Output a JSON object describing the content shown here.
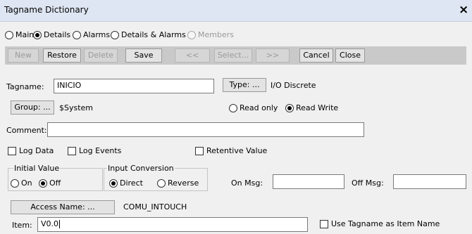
{
  "window": {
    "title": "Tagname Dictionary",
    "close_label": "×"
  },
  "view_tabs": [
    {
      "label": "Main",
      "selected": false,
      "disabled": false
    },
    {
      "label": "Details",
      "selected": true,
      "disabled": false
    },
    {
      "label": "Alarms",
      "selected": false,
      "disabled": false
    },
    {
      "label": "Details & Alarms",
      "selected": false,
      "disabled": false
    },
    {
      "label": "Members",
      "selected": false,
      "disabled": true
    }
  ],
  "toolbar": {
    "new": "New",
    "restore": "Restore",
    "delete": "Delete",
    "save": "Save",
    "prev": "<<",
    "select": "Select...",
    "next": ">>",
    "cancel": "Cancel",
    "close": "Close"
  },
  "form": {
    "tagname_label": "Tagname:",
    "tagname_value": "INICIO",
    "type_button": "Type: ...",
    "type_value": "I/O Discrete",
    "group_button": "Group: ...",
    "group_value": "$System",
    "access_options": [
      {
        "label": "Read only",
        "selected": false
      },
      {
        "label": "Read Write",
        "selected": true
      }
    ],
    "comment_label": "Comment:",
    "comment_value": "",
    "checks": {
      "log_data": "Log Data",
      "log_events": "Log Events",
      "retentive_value": "Retentive Value"
    },
    "initial_value": {
      "title": "Initial Value",
      "options": [
        {
          "label": "On",
          "selected": false
        },
        {
          "label": "Off",
          "selected": true
        }
      ]
    },
    "input_conversion": {
      "title": "Input Conversion",
      "options": [
        {
          "label": "Direct",
          "selected": true
        },
        {
          "label": "Reverse",
          "selected": false
        }
      ]
    },
    "on_msg_label": "On Msg:",
    "on_msg_value": "",
    "off_msg_label": "Off Msg:",
    "off_msg_value": "",
    "access_name_button": "Access Name: ...",
    "access_name_value": "COMU_INTOUCH",
    "item_label": "Item:",
    "item_value": "V0.0",
    "use_tagname_label": "Use Tagname as Item Name"
  }
}
